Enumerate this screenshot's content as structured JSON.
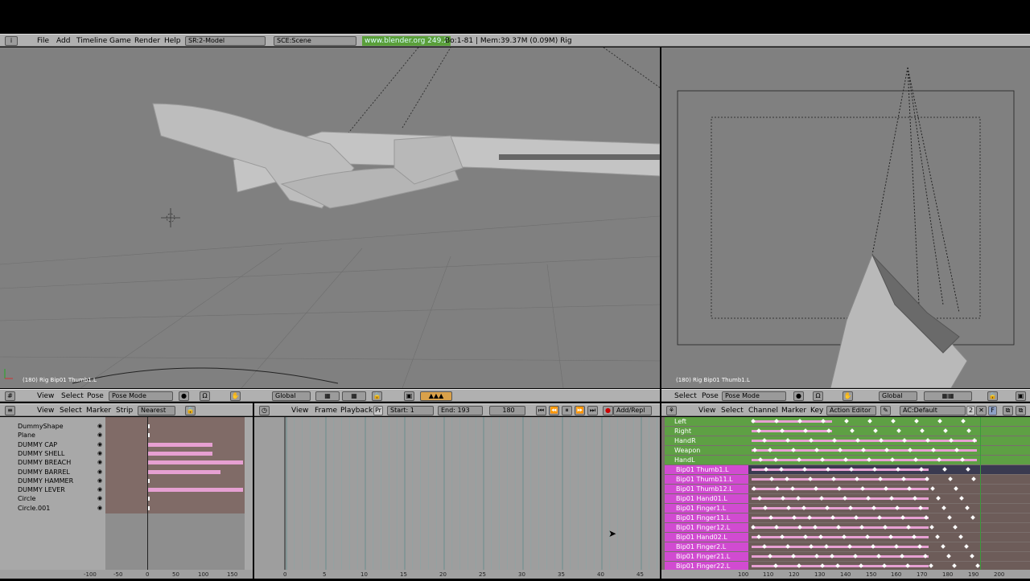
{
  "topbar": {
    "menu": [
      "File",
      "Add",
      "Timeline",
      "Game",
      "Render",
      "Help"
    ],
    "screen": "SR:2-Model",
    "scene": "SCE:Scene",
    "website": "www.blender.org 249.2",
    "stats": "Bo:1-81  | Mem:39.37M (0.09M) Rig"
  },
  "viewport_left": {
    "label": "(180) Rig Bip01 Thumb1.L"
  },
  "viewport_right": {
    "label": "(180) Rig Bip01 Thumb1.L"
  },
  "header3d_left": {
    "menus": [
      "View",
      "Select",
      "Pose"
    ],
    "mode": "Pose Mode",
    "orientation": "Global"
  },
  "header3d_right": {
    "menus": [
      "Select",
      "Pose"
    ],
    "mode": "Pose Mode",
    "orientation": "Global"
  },
  "nla": {
    "menus": [
      "View",
      "Select",
      "Marker",
      "Strip"
    ],
    "snap": "Nearest",
    "objects": [
      "DummyShape",
      "Plane",
      "DUMMY CAP",
      "DUMMY SHELL",
      "DUMMY BREACH",
      "DUMMY BARREL",
      "DUMMY HAMMER",
      "DUMMY LEVER",
      "Circle",
      "Circle.001"
    ],
    "ticks": [
      "-100",
      "-50",
      "0",
      "50",
      "100",
      "150"
    ]
  },
  "timeline": {
    "menus": [
      "View",
      "Frame",
      "Playback"
    ],
    "pr": "Pr",
    "start": "Start: 1",
    "end": "End: 193",
    "current": "180",
    "keying": "Add/Repl",
    "ticks": [
      "0",
      "5",
      "10",
      "15",
      "20",
      "25",
      "30",
      "35",
      "40",
      "45"
    ]
  },
  "action": {
    "menus": [
      "View",
      "Select",
      "Channel",
      "Marker",
      "Key"
    ],
    "editor": "Action Editor",
    "action_name": "AC:Default",
    "users": "2",
    "fake": "F",
    "groups": [
      "Left",
      "Right",
      "HandR",
      "Weapon",
      "HandL"
    ],
    "channels": [
      "Bip01 Thumb1.L",
      "Bip01 Thumb11.L",
      "Bip01 Thumb12.L",
      "Bip01 Hand01.L",
      "Bip01 Finger1.L",
      "Bip01 Finger11.L",
      "Bip01 Finger12.L",
      "Bip01 Hand02.L",
      "Bip01 Finger2.L",
      "Bip01 Finger21.L",
      "Bip01 Finger22.L"
    ],
    "ticks": [
      "100",
      "110",
      "120",
      "130",
      "140",
      "150",
      "160",
      "170",
      "180",
      "190",
      "200"
    ]
  },
  "colors": {
    "group": "#5ea044",
    "channel": "#d14bd1",
    "keystrip": "#e6a0d2",
    "viewport": "#808080"
  }
}
